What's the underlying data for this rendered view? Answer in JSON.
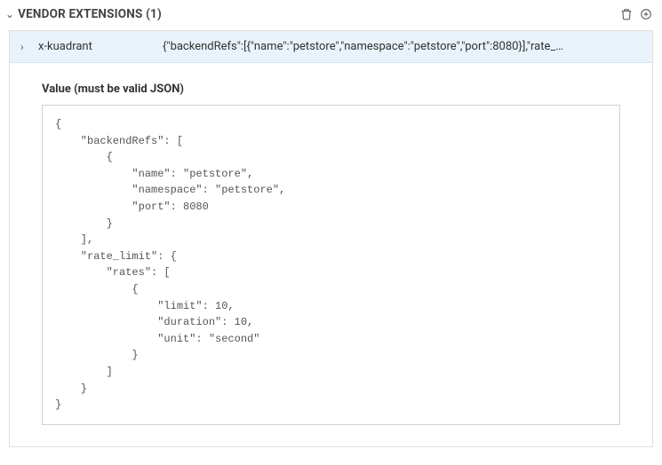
{
  "section": {
    "title": "VENDOR EXTENSIONS (1)"
  },
  "extension": {
    "key": "x-kuadrant",
    "preview": "{\"backendRefs\":[{\"name\":\"petstore\",\"namespace\":\"petstore\",\"port\":8080}],\"rate_…"
  },
  "detail": {
    "label": "Value (must be valid JSON)",
    "json": "{\n    \"backendRefs\": [\n        {\n            \"name\": \"petstore\",\n            \"namespace\": \"petstore\",\n            \"port\": 8080\n        }\n    ],\n    \"rate_limit\": {\n        \"rates\": [\n            {\n                \"limit\": 10,\n                \"duration\": 10,\n                \"unit\": \"second\"\n            }\n        ]\n    }\n}"
  }
}
